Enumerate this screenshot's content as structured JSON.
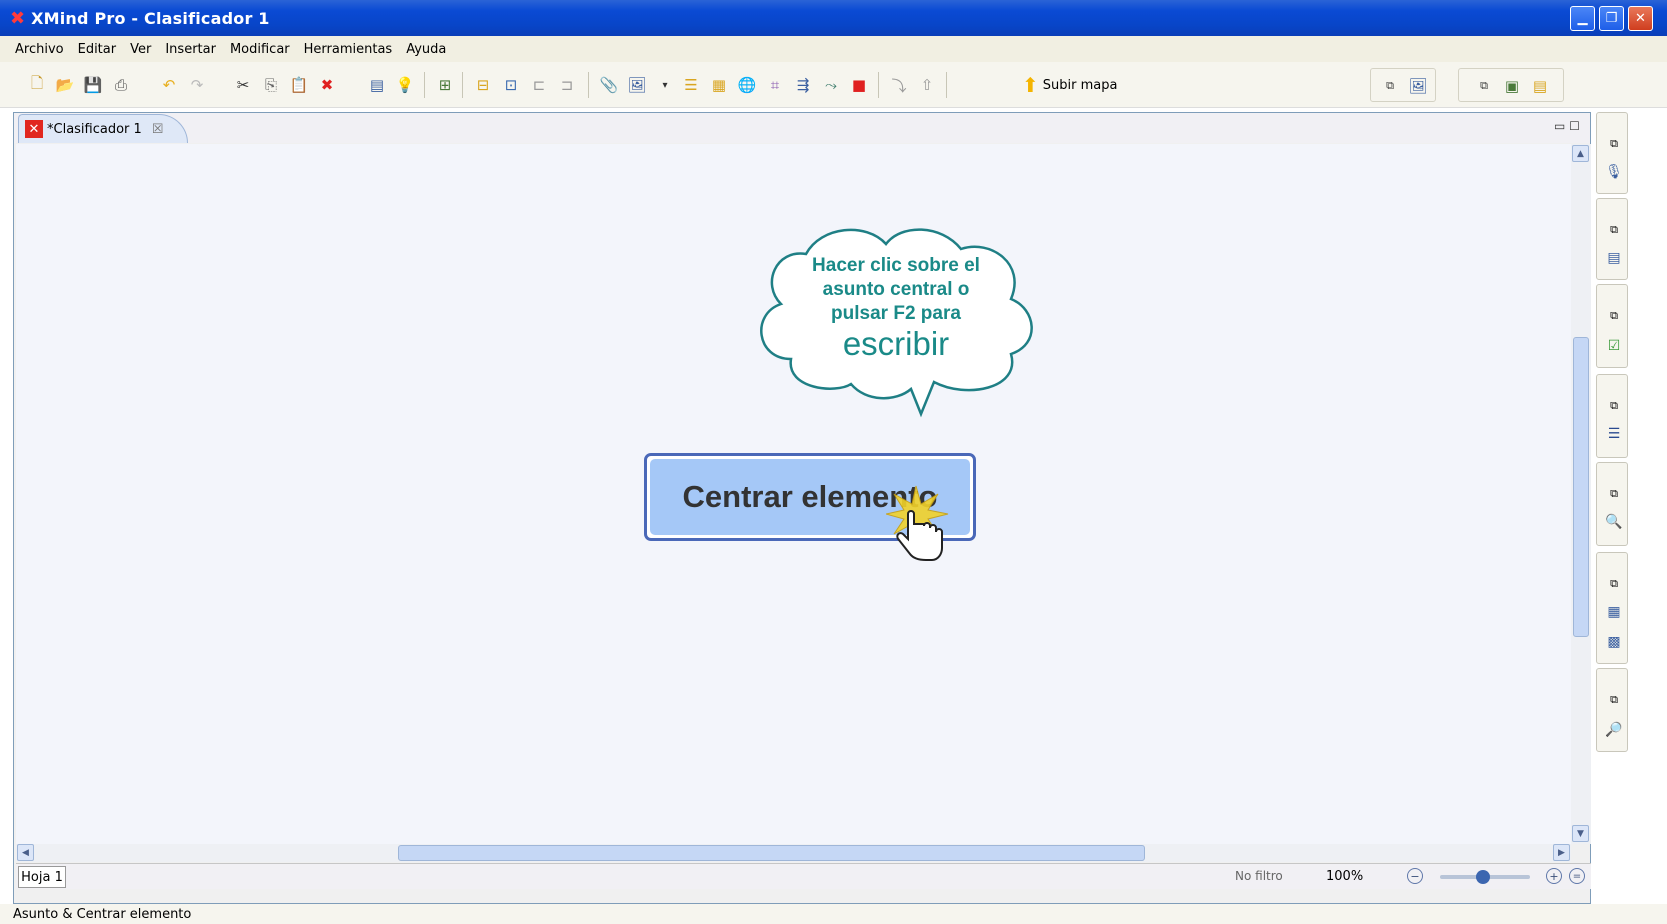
{
  "window": {
    "title": "XMind Pro - Clasificador 1",
    "app_icon": "xmind-x-icon"
  },
  "menu": [
    "Archivo",
    "Editar",
    "Ver",
    "Insertar",
    "Modificar",
    "Herramientas",
    "Ayuda"
  ],
  "toolbar": {
    "subir_mapa_label": "Subir mapa"
  },
  "tab": {
    "label": "*Clasificador 1"
  },
  "canvas": {
    "callout_lines": [
      "Hacer clic sobre el",
      "asunto central o",
      "pulsar F2 para"
    ],
    "callout_big": "escribir",
    "central_topic": "Centrar elemento"
  },
  "editor_status": {
    "sheet": "Hoja 1",
    "filter": "No filtro",
    "zoom": "100%"
  },
  "statusbar": {
    "text": "Asunto & Centrar elemento"
  },
  "colors": {
    "titlebar": "#0a4ad4",
    "topic_fill": "#a5c8f7",
    "topic_border": "#4a68b8",
    "callout_text": "#1a8a88"
  }
}
